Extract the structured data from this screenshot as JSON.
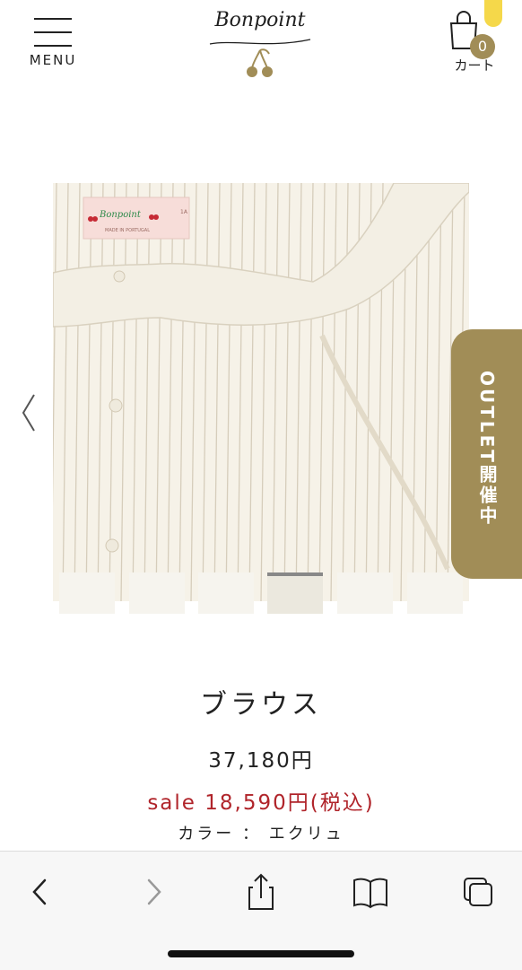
{
  "header": {
    "menu_label": "MENU",
    "logo_text": "Bonpoint",
    "cart_count": "0",
    "cart_label": "カート"
  },
  "gallery": {
    "prev_icon": "chevron-left-icon",
    "thumbnail_count": 6,
    "active_thumbnail": 4,
    "label_brand": "Bonpoint",
    "label_made_in": "MADE IN PORTUGAL",
    "label_size": "1A"
  },
  "outlet_tab": {
    "label": "OUTLET開催中"
  },
  "product": {
    "name": "ブラウス",
    "price": "37,180円",
    "sale_price": "sale 18,590円(税込)",
    "color": "カラー ： エクリュ"
  },
  "toolbar": {
    "icons": [
      "back-icon",
      "forward-icon",
      "share-icon",
      "bookmarks-icon",
      "tabs-icon"
    ]
  },
  "colors": {
    "accent_gold": "#a18d57",
    "sale_red": "#b0242a",
    "cart_highlight": "#f5d84a"
  }
}
